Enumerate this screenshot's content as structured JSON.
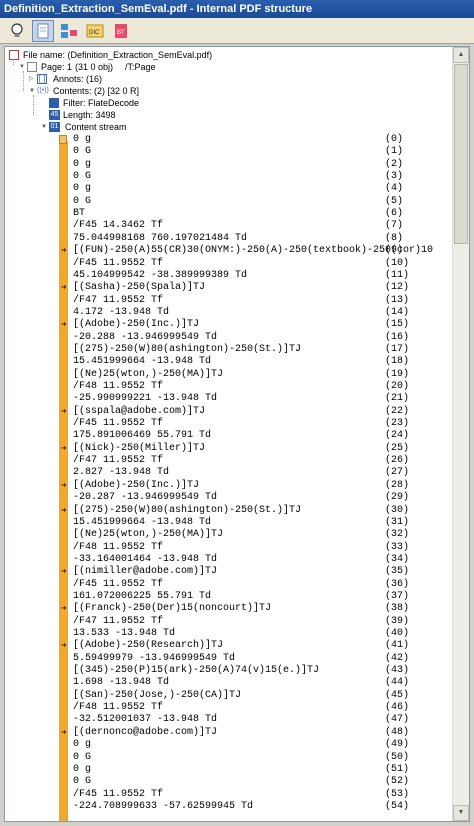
{
  "window": {
    "title": "Definition_Extraction_SemEval.pdf - Internal PDF structure"
  },
  "toolbar": {
    "buttons": [
      "light-bulb-icon",
      "page-icon",
      "structure-icon",
      "dictionary-icon",
      "text-object-icon"
    ]
  },
  "tree": {
    "file": "File name: (Definition_Extraction_SemEval.pdf)",
    "page_label": "Page: 1",
    "page_obj": "(31 0 obj)",
    "page_type": "/T:Page",
    "annots": "Annots:  (16)",
    "contents": "Contents:  (2) [32 0 R]",
    "filter": "Filter:  FlateDecode",
    "length": "Length:  3498",
    "content_stream": "Content stream"
  },
  "stream": [
    {
      "text": "0 g",
      "n": "(0)",
      "marker": "box"
    },
    {
      "text": "0 G",
      "n": "(1)"
    },
    {
      "text": "0 g",
      "n": "(2)"
    },
    {
      "text": "0 G",
      "n": "(3)"
    },
    {
      "text": "0 g",
      "n": "(4)"
    },
    {
      "text": "0 G",
      "n": "(5)"
    },
    {
      "text": "BT",
      "n": "(6)"
    },
    {
      "text": "/F45 14.3462 Tf",
      "n": "(7)"
    },
    {
      "text": "75.044998168 760.197021484 Td",
      "n": "(8)"
    },
    {
      "text": "[(FUN)-250(A)55(CR)30(ONYM:)-250(A)-250(textbook)-250(cor)10",
      "n": "(9)",
      "arrow": true
    },
    {
      "text": "/F45 11.9552 Tf",
      "n": "(10)"
    },
    {
      "text": "45.104999542 -38.389999389 Td",
      "n": "(11)"
    },
    {
      "text": "[(Sasha)-250(Spala)]TJ",
      "n": "(12)",
      "arrow": true
    },
    {
      "text": "/F47 11.9552 Tf",
      "n": "(13)"
    },
    {
      "text": "4.172 -13.948 Td",
      "n": "(14)"
    },
    {
      "text": "[(Adobe)-250(Inc.)]TJ",
      "n": "(15)",
      "arrow": true
    },
    {
      "text": "-20.288 -13.946999549 Td",
      "n": "(16)"
    },
    {
      "text": "[(275)-250(W)80(ashington)-250(St.)]TJ",
      "n": "(17)"
    },
    {
      "text": "15.451999664 -13.948 Td",
      "n": "(18)"
    },
    {
      "text": "[(Ne)25(wton,)-250(MA)]TJ",
      "n": "(19)"
    },
    {
      "text": "/F48 11.9552 Tf",
      "n": "(20)"
    },
    {
      "text": "-25.990999221 -13.948 Td",
      "n": "(21)"
    },
    {
      "text": "[(sspala@adobe.com)]TJ",
      "n": "(22)",
      "arrow": true
    },
    {
      "text": "/F45 11.9552 Tf",
      "n": "(23)"
    },
    {
      "text": "175.891006469 55.791 Td",
      "n": "(24)"
    },
    {
      "text": "[(Nick)-250(Miller)]TJ",
      "n": "(25)",
      "arrow": true
    },
    {
      "text": "/F47 11.9552 Tf",
      "n": "(26)"
    },
    {
      "text": "2.827 -13.948 Td",
      "n": "(27)"
    },
    {
      "text": "[(Adobe)-250(Inc.)]TJ",
      "n": "(28)",
      "arrow": true
    },
    {
      "text": "-20.287 -13.946999549 Td",
      "n": "(29)"
    },
    {
      "text": "[(275)-250(W)80(ashington)-250(St.)]TJ",
      "n": "(30)",
      "arrow": true
    },
    {
      "text": "15.451999664 -13.948 Td",
      "n": "(31)"
    },
    {
      "text": "[(Ne)25(wton,)-250(MA)]TJ",
      "n": "(32)"
    },
    {
      "text": "/F48 11.9552 Tf",
      "n": "(33)"
    },
    {
      "text": "-33.164001464 -13.948 Td",
      "n": "(34)"
    },
    {
      "text": "[(nimiller@adobe.com)]TJ",
      "n": "(35)",
      "arrow": true
    },
    {
      "text": "/F45 11.9552 Tf",
      "n": "(36)"
    },
    {
      "text": "161.072006225 55.791 Td",
      "n": "(37)"
    },
    {
      "text": "[(Franck)-250(Der)15(noncourt)]TJ",
      "n": "(38)",
      "arrow": true
    },
    {
      "text": "/F47 11.9552 Tf",
      "n": "(39)"
    },
    {
      "text": "13.533 -13.948 Td",
      "n": "(40)"
    },
    {
      "text": "[(Adobe)-250(Research)]TJ",
      "n": "(41)",
      "arrow": true
    },
    {
      "text": "5.59499979 -13.946999549 Td",
      "n": "(42)"
    },
    {
      "text": "[(345)-250(P)15(ark)-250(A)74(v)15(e.)]TJ",
      "n": "(43)"
    },
    {
      "text": "1.698 -13.948 Td",
      "n": "(44)"
    },
    {
      "text": "[(San)-250(Jose,)-250(CA)]TJ",
      "n": "(45)"
    },
    {
      "text": "/F48 11.9552 Tf",
      "n": "(46)"
    },
    {
      "text": "-32.512001037 -13.948 Td",
      "n": "(47)"
    },
    {
      "text": "[(dernonco@adobe.com)]TJ",
      "n": "(48)",
      "arrow": true
    },
    {
      "text": "0 g",
      "n": "(49)"
    },
    {
      "text": "0 G",
      "n": "(50)"
    },
    {
      "text": "0 g",
      "n": "(51)"
    },
    {
      "text": "0 G",
      "n": "(52)"
    },
    {
      "text": "/F45 11.9552 Tf",
      "n": "(53)"
    },
    {
      "text": "-224.708999633 -57.62599945 Td",
      "n": "(54)"
    }
  ]
}
